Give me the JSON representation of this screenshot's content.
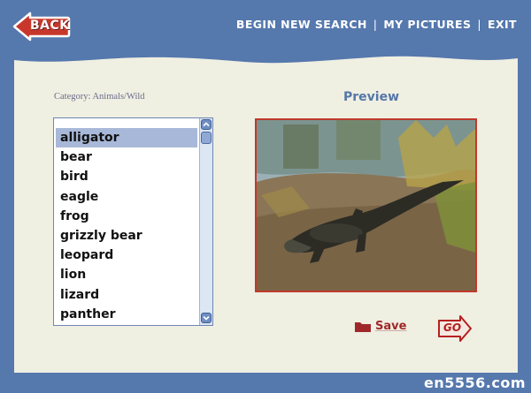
{
  "header": {
    "back_label": "BACK",
    "nav": {
      "begin_new_search": "BEGIN NEW SEARCH",
      "sep1": "|",
      "my_pictures": "MY PICTURES",
      "sep2": "|",
      "exit": "EXIT"
    }
  },
  "category_label": "Category: Animals/Wild",
  "preview_title": "Preview",
  "list": {
    "selected": "alligator",
    "items": [
      "alligator",
      "bear",
      "bird",
      "eagle",
      "frog",
      "grizzly bear",
      "leopard",
      "lion",
      "lizard",
      "panther"
    ]
  },
  "actions": {
    "save_label": "Save",
    "go_label": "GO"
  },
  "watermark": "en5556.com",
  "colors": {
    "header_blue": "#5578ad",
    "panel_bg": "#efefe2",
    "accent_red": "#b52020",
    "selection": "#a8b8d8"
  }
}
